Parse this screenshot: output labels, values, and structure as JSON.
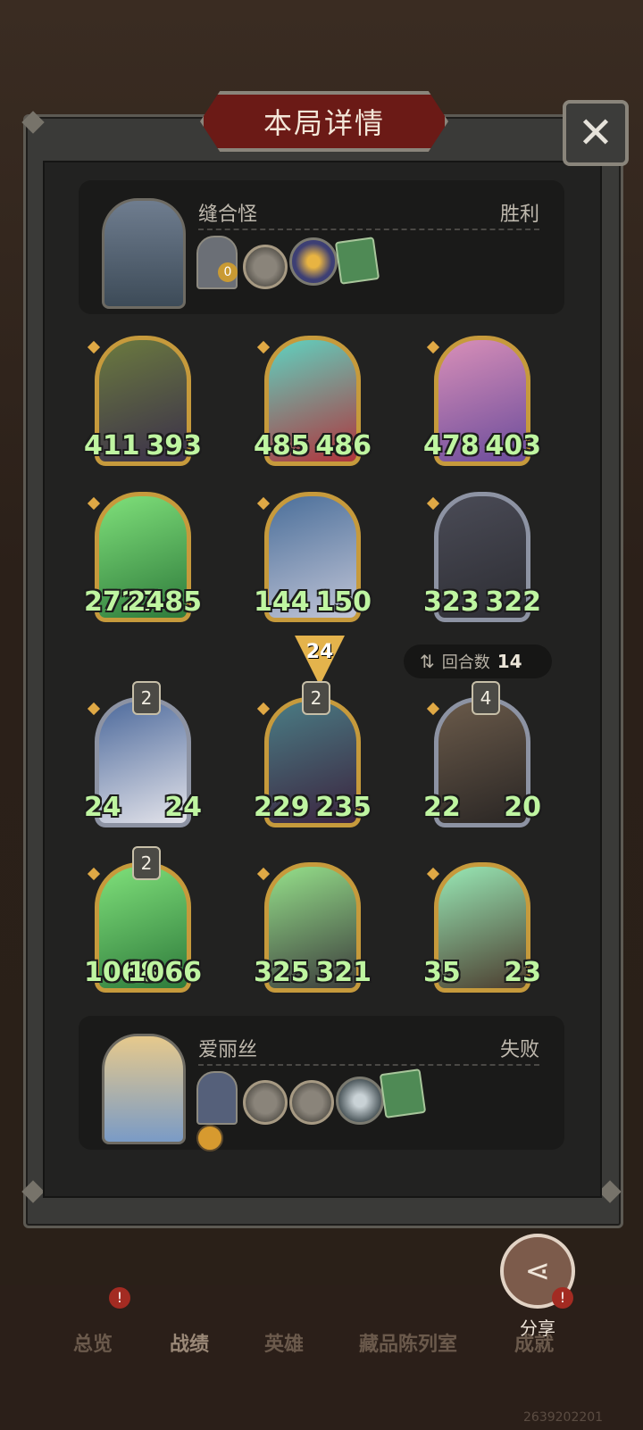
{
  "header": {
    "title": "本局详情"
  },
  "close_icon": "✕",
  "top_player": {
    "name": "缝合怪",
    "result": "胜利",
    "items": [
      "card-back-icon",
      "pocket-watch-icon",
      "dark-orb-icon",
      "green-book-icon"
    ],
    "item_counter": "0"
  },
  "top_board": [
    {
      "atk": "411",
      "hp": "393",
      "tier": null
    },
    {
      "atk": "485",
      "hp": "486",
      "tier": null
    },
    {
      "atk": "478",
      "hp": "403",
      "tier": null
    },
    {
      "atk": "2727",
      "hp": "2485",
      "tier": null
    },
    {
      "atk": "144",
      "hp": "150",
      "tier": null
    },
    {
      "atk": "323",
      "hp": "322",
      "tier": null
    }
  ],
  "turn_indicator": "24",
  "round": {
    "label": "回合数",
    "value": "14"
  },
  "bottom_board": [
    {
      "atk": "24",
      "hp": "24",
      "tier": "2"
    },
    {
      "atk": "229",
      "hp": "235",
      "tier": "2"
    },
    {
      "atk": "22",
      "hp": "20",
      "tier": "4"
    },
    {
      "atk": "1068",
      "hp": "1066",
      "tier": "2"
    },
    {
      "atk": "325",
      "hp": "321",
      "tier": null
    },
    {
      "atk": "35",
      "hp": "23",
      "tier": null
    }
  ],
  "bottom_player": {
    "name": "爱丽丝",
    "result": "失败",
    "items": [
      "card-back-icon",
      "pocket-watch-icon",
      "pocket-watch-icon",
      "crystal-orb-icon",
      "green-book-icon",
      "gold-coin-icon"
    ]
  },
  "share": {
    "label": "分享",
    "icon": "share-icon"
  },
  "tabs": [
    {
      "label": "总览",
      "badge": "!"
    },
    {
      "label": "战绩",
      "badge": null
    },
    {
      "label": "英雄",
      "badge": null
    },
    {
      "label": "藏品陈列室",
      "badge": null
    },
    {
      "label": "成就",
      "badge": "!"
    }
  ],
  "uid": "2639202201"
}
